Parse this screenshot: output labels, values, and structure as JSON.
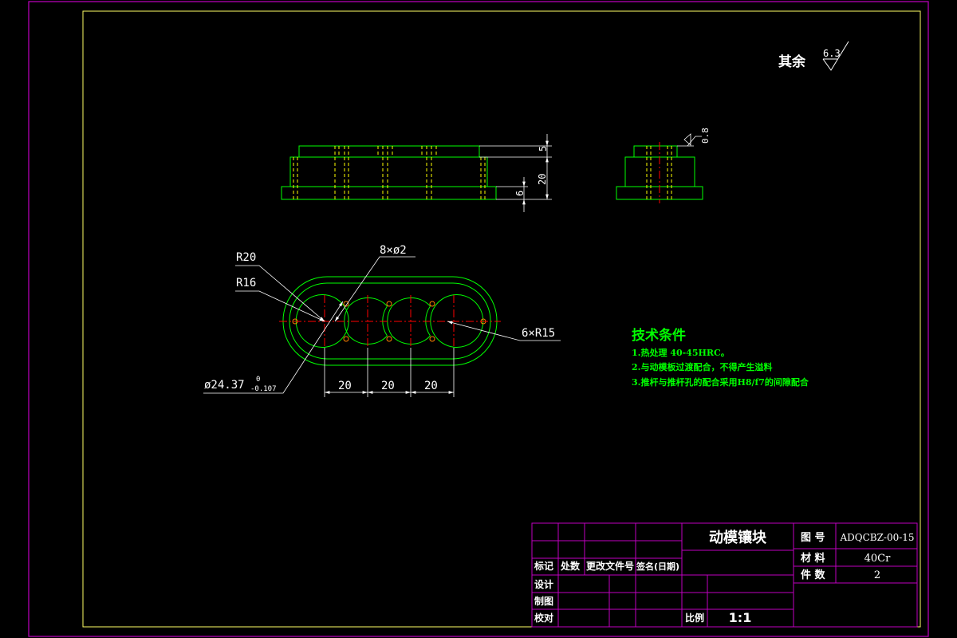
{
  "colors": {
    "background": "#000000",
    "outer_border": "#c000c0",
    "inner_border": "#ffff66",
    "outline": "#00ff00",
    "hidden_line": "#ffff00",
    "center_line": "#ff0000",
    "dimension": "#ffffff",
    "notes": "#00ff00",
    "title_block_lines": "#c000c0",
    "title_block_text": "#ffffff"
  },
  "surface_finish": {
    "label": "其余",
    "roughness_main": "6.3",
    "roughness_side": "0.8"
  },
  "dimensions": {
    "front_top_step": "5",
    "front_height": "20",
    "front_base": "6",
    "r20": "R20",
    "r16": "R16",
    "holes": "8×ø2",
    "arcs": "6×R15",
    "diameter": "ø24.37",
    "diameter_tol_upper": "0",
    "diameter_tol_lower": "-0.107",
    "pitch_1": "20",
    "pitch_2": "20",
    "pitch_3": "20"
  },
  "notes": {
    "title": "技术条件",
    "items": [
      "1.热处理 40-45HRC。",
      "2.与动模板过渡配合，不得产生溢料",
      "3.推杆与推杆孔的配合采用H8/f7的间隙配合"
    ]
  },
  "title_block": {
    "part_name": "动模镶块",
    "drawing_no_label": "图 号",
    "drawing_no": "ADQCBZ-00-15",
    "material_label": "材 料",
    "material": "40Cr",
    "quantity_label": "件 数",
    "quantity": "2",
    "rev_mark": "标记",
    "rev_count": "处数",
    "rev_doc": "更改文件号",
    "rev_sign": "签名(日期)",
    "design": "设计",
    "draft": "制图",
    "check": "校对",
    "scale_label": "比例",
    "scale": "1:1"
  }
}
